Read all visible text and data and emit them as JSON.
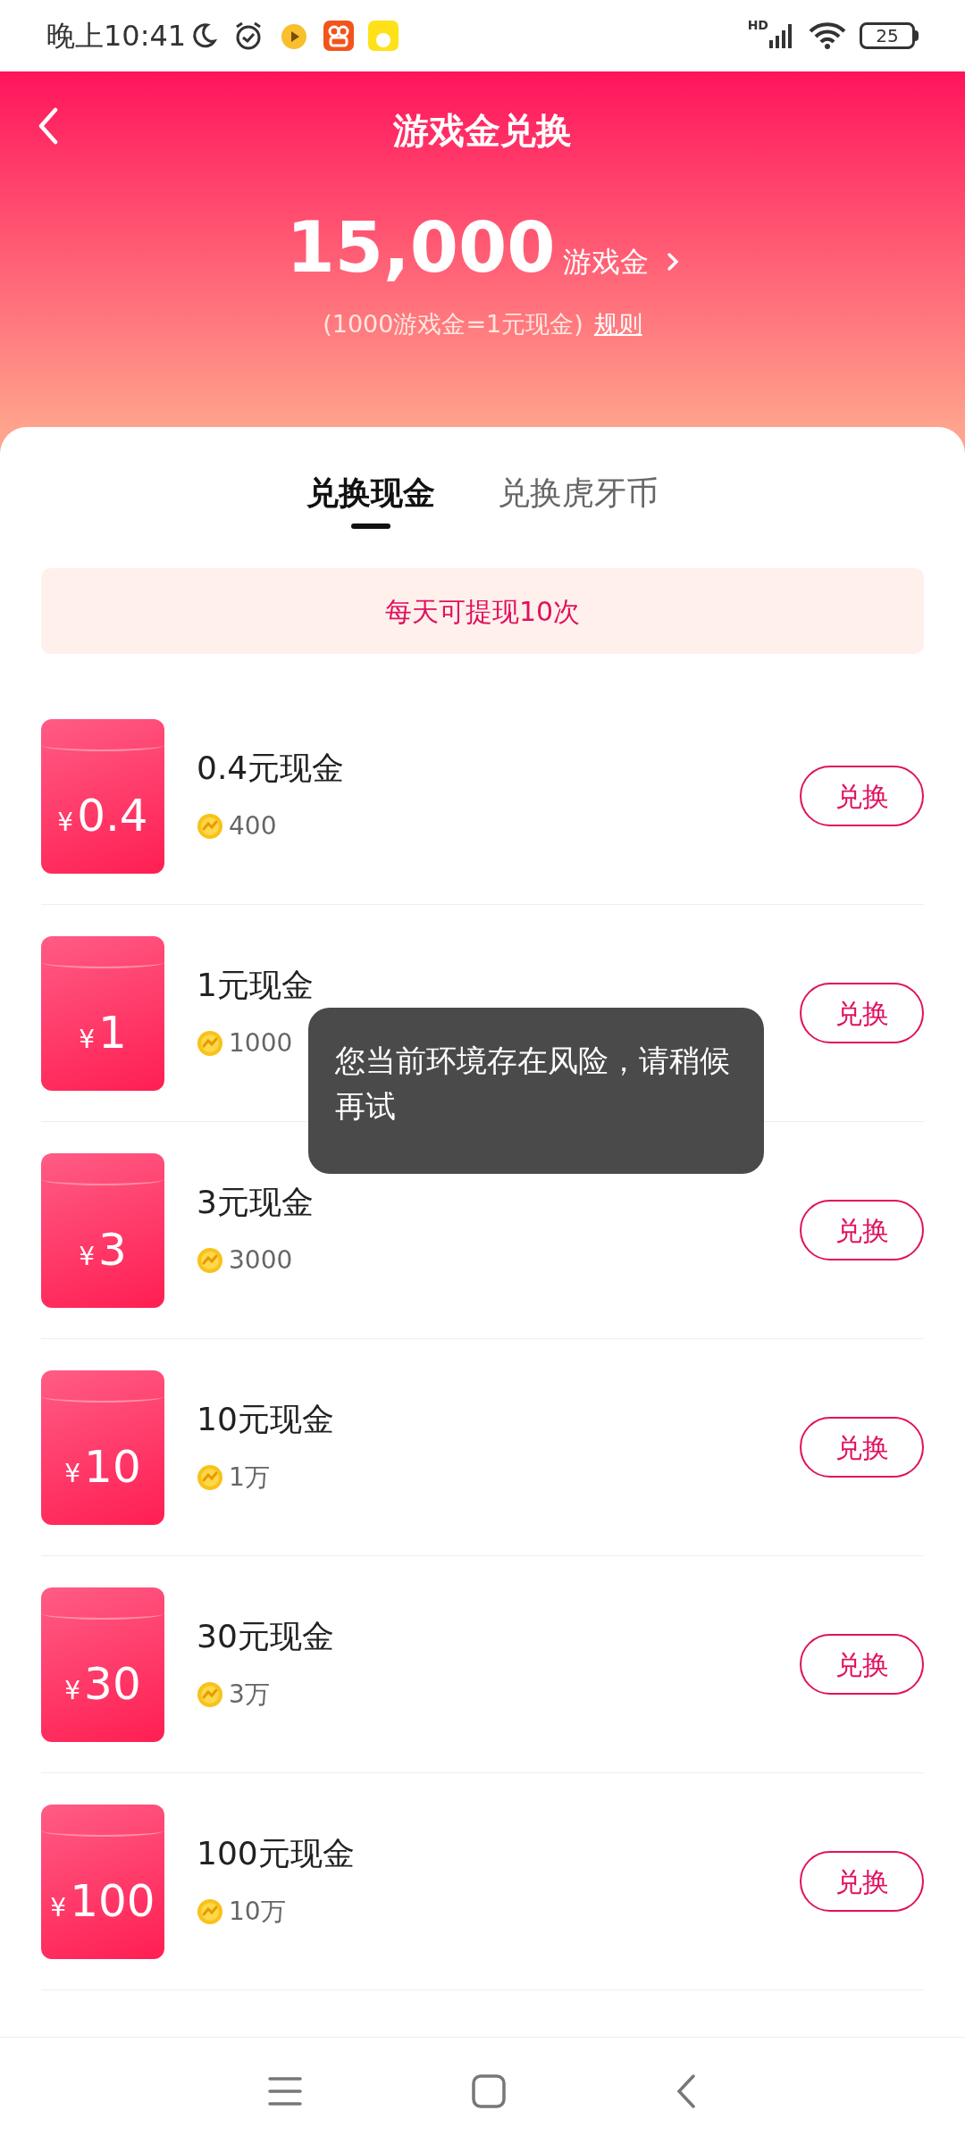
{
  "status_bar": {
    "time": "晚上10:41",
    "network": "HD",
    "battery": "25"
  },
  "header": {
    "title": "游戏金兑换",
    "balance": "15,000",
    "unit": "游戏金",
    "rate": "(1000游戏金=1元现金)",
    "rules_link": "规则"
  },
  "tabs": [
    {
      "label": "兑换现金",
      "selected": true
    },
    {
      "label": "兑换虎牙币",
      "selected": false
    }
  ],
  "notice": "每天可提现10次",
  "items": [
    {
      "currency": "¥",
      "amount": "0.4",
      "title": "0.4元现金",
      "cost": "400",
      "button": "兑换"
    },
    {
      "currency": "¥",
      "amount": "1",
      "title": "1元现金",
      "cost": "1000",
      "button": "兑换"
    },
    {
      "currency": "¥",
      "amount": "3",
      "title": "3元现金",
      "cost": "3000",
      "button": "兑换"
    },
    {
      "currency": "¥",
      "amount": "10",
      "title": "10元现金",
      "cost": "1万",
      "button": "兑换"
    },
    {
      "currency": "¥",
      "amount": "30",
      "title": "30元现金",
      "cost": "3万",
      "button": "兑换"
    },
    {
      "currency": "¥",
      "amount": "100",
      "title": "100元现金",
      "cost": "10万",
      "button": "兑换"
    }
  ],
  "toast": "您当前环境存在风险，请稍候再试"
}
